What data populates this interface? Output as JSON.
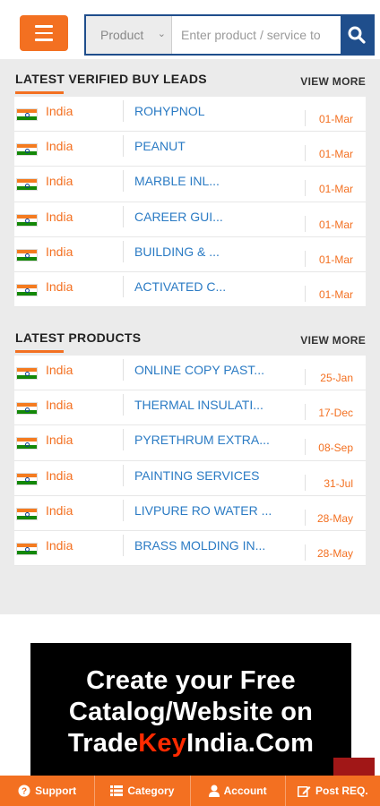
{
  "header": {
    "search_select_value": "Product",
    "search_placeholder": "Enter product / service to"
  },
  "buy_leads": {
    "title": "LATEST VERIFIED BUY LEADS",
    "view_more": "VIEW MORE",
    "rows": [
      {
        "country": "India",
        "name": "ROHYPNOL",
        "date": "01-Mar"
      },
      {
        "country": "India",
        "name": "PEANUT",
        "date": "01-Mar"
      },
      {
        "country": "India",
        "name": "MARBLE INL...",
        "date": "01-Mar"
      },
      {
        "country": "India",
        "name": "CAREER GUI...",
        "date": "01-Mar"
      },
      {
        "country": "India",
        "name": "BUILDING & ...",
        "date": "01-Mar"
      },
      {
        "country": "India",
        "name": "ACTIVATED C...",
        "date": "01-Mar"
      }
    ]
  },
  "products": {
    "title": "LATEST PRODUCTS",
    "view_more": "VIEW MORE",
    "rows": [
      {
        "country": "India",
        "name": "ONLINE COPY PAST...",
        "date": "25-Jan"
      },
      {
        "country": "India",
        "name": "THERMAL INSULATI...",
        "date": "17-Dec"
      },
      {
        "country": "India",
        "name": "PYRETHRUM EXTRA...",
        "date": "08-Sep"
      },
      {
        "country": "India",
        "name": "PAINTING SERVICES",
        "date": "31-Jul"
      },
      {
        "country": "India",
        "name": "LIVPURE RO WATER ...",
        "date": "28-May"
      },
      {
        "country": "India",
        "name": "BRASS MOLDING IN...",
        "date": "28-May"
      }
    ]
  },
  "banner": {
    "line1": "Create your Free",
    "line2": "Catalog/Website on",
    "brand_trade": "Trade",
    "brand_key": "Key",
    "brand_rest": "India.Com"
  },
  "bottom_nav": {
    "support": "Support",
    "category": "Category",
    "account": "Account",
    "post_req": "Post REQ."
  },
  "colors": {
    "accent": "#f37021",
    "brand_blue": "#1f4e8c",
    "link": "#2b7bc4",
    "brand_key_red": "#ff2a00"
  }
}
